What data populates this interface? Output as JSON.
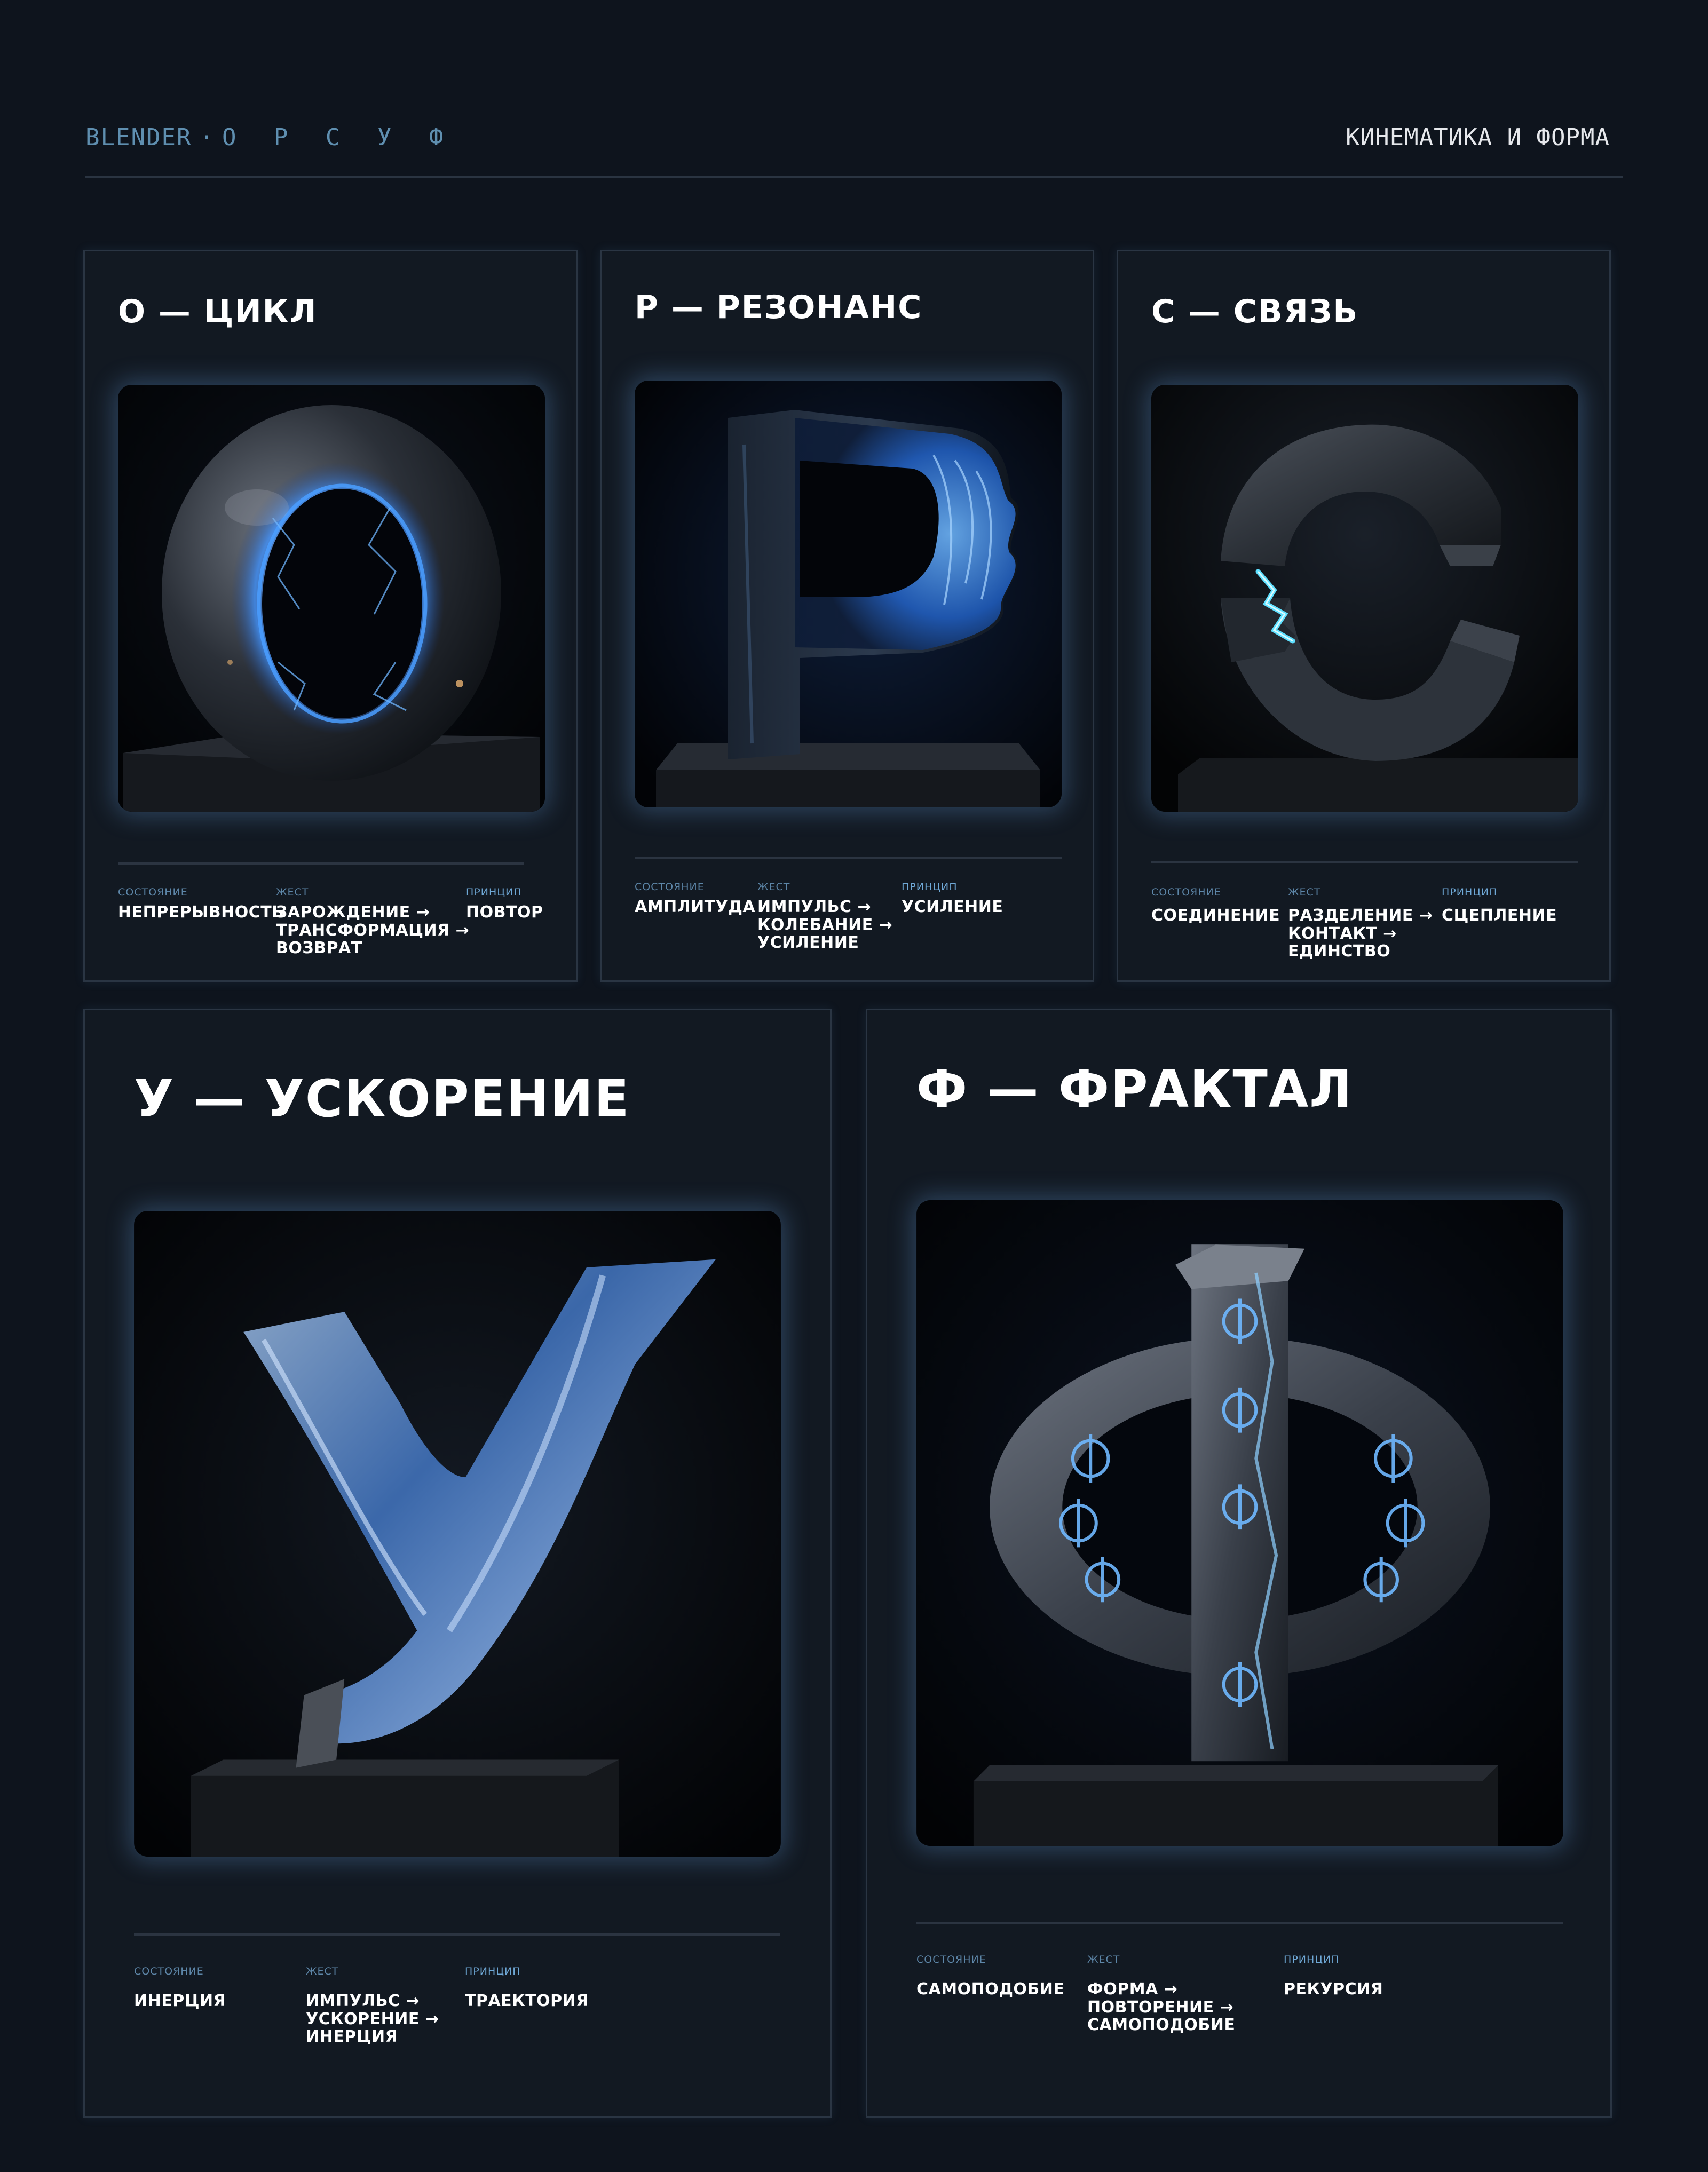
{
  "header": {
    "brand": "BLENDER",
    "separator": "·",
    "letters": "О Р С У Ф",
    "subtitle": "КИНЕМАТИКА И ФОРМА"
  },
  "labels": {
    "state": "СОСТОЯНИЕ",
    "gesture": "ЖЕСТ",
    "principle": "ПРИНЦИП"
  },
  "cards": [
    {
      "title": "О — ЦИКЛ",
      "state": "НЕПРЕРЫВНОСТЬ",
      "gesture": [
        "ЗАРОЖДЕНИЕ →",
        "ТРАНСФОРМАЦИЯ →",
        "ВОЗВРАТ"
      ],
      "principle": "ПОВТОР"
    },
    {
      "title": "Р — РЕЗОНАНС",
      "state": "АМПЛИТУДА",
      "gesture": [
        "ИМПУЛЬС →",
        "КОЛЕБАНИЕ →",
        "УСИЛЕНИЕ"
      ],
      "principle": "УСИЛЕНИЕ"
    },
    {
      "title": "С — СВЯЗЬ",
      "state": "СОЕДИНЕНИЕ",
      "gesture": [
        "РАЗДЕЛЕНИЕ →",
        "КОНТАКТ →",
        "ЕДИНСТВО"
      ],
      "principle": "СЦЕПЛЕНИЕ"
    },
    {
      "title": "У — УСКОРЕНИЕ",
      "state": "ИНЕРЦИЯ",
      "gesture": [
        "ИМПУЛЬС →",
        "УСКОРЕНИЕ →",
        "ИНЕРЦИЯ"
      ],
      "principle": "ТРАЕКТОРИЯ"
    },
    {
      "title": "Ф — ФРАКТАЛ",
      "state": "САМОПОДОБИЕ",
      "gesture": [
        "ФОРМА →",
        "ПОВТОРЕНИЕ →",
        "САМОПОДОБИЕ"
      ],
      "principle": "РЕКУРСИЯ"
    }
  ],
  "colors": {
    "background": "#0e141d",
    "card": "#121922",
    "accent_glow": "#6fa8e8",
    "caption": "#5d86a8"
  }
}
